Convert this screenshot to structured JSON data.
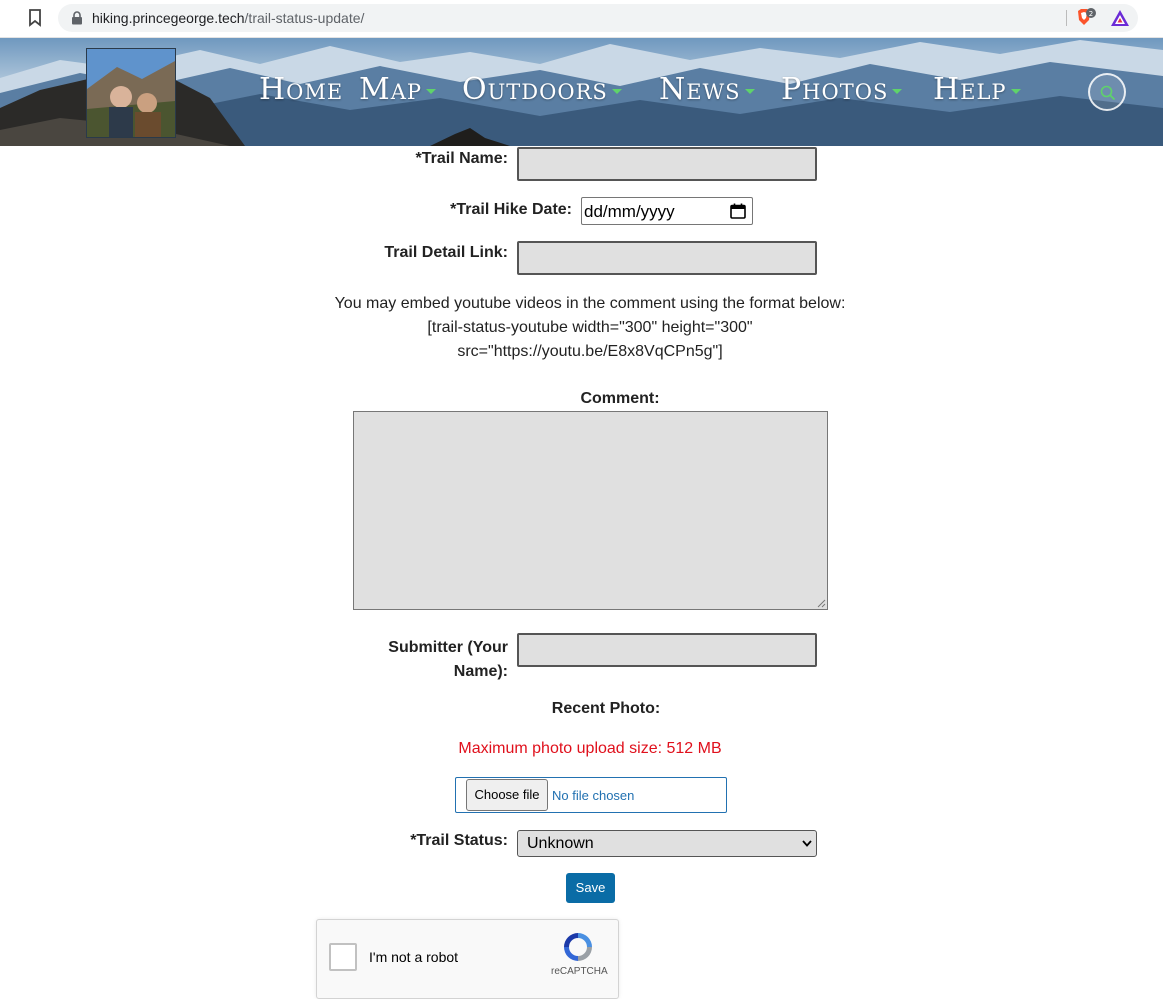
{
  "browser": {
    "url_host": "hiking.princegeorge.tech",
    "url_path": "/trail-status-update/",
    "brave_badge": "2"
  },
  "nav": {
    "items": [
      {
        "label": "Home",
        "has_caret": false
      },
      {
        "label": "Map",
        "has_caret": true
      },
      {
        "label": "Outdoors",
        "has_caret": true
      },
      {
        "label": "News",
        "has_caret": true
      },
      {
        "label": "Photos",
        "has_caret": true
      },
      {
        "label": "Help",
        "has_caret": true
      }
    ],
    "caret_color": "#5fd36a"
  },
  "form": {
    "trail_name_label": "*Trail Name:",
    "trail_hike_date_label": "*Trail Hike Date:",
    "trail_hike_date_placeholder": "dd/mm/yyyy",
    "trail_detail_link_label": "Trail Detail Link:",
    "youtube_info_line1": "You may embed youtube videos in the comment using the format below:",
    "youtube_info_line2": "[trail-status-youtube width=\"300\" height=\"300\"",
    "youtube_info_line3": "src=\"https://youtu.be/E8x8VqCPn5g\"]",
    "comment_label": "Comment:",
    "submitter_label_line1": "Submitter (Your",
    "submitter_label_line2": "Name):",
    "recent_photo_label": "Recent Photo:",
    "max_upload_text": "Maximum photo upload size: 512 MB",
    "choose_file_label": "Choose file",
    "no_file_text": "No file chosen",
    "trail_status_label": "*Trail Status:",
    "trail_status_value": "Unknown",
    "save_label": "Save"
  },
  "recaptcha": {
    "checkbox_label": "I'm not a robot",
    "brand": "reCAPTCHA"
  },
  "colors": {
    "error_text": "#e0101c",
    "primary_button": "#0a6ca6",
    "input_background": "#e0e0e0"
  }
}
